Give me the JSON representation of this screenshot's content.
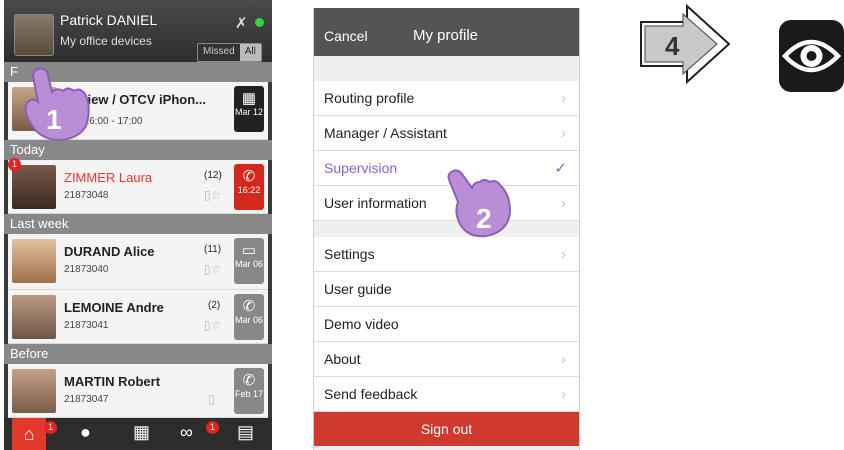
{
  "phone1": {
    "header": {
      "name": "Patrick DANIEL",
      "subtitle": "My office devices",
      "filter_missed": "Missed",
      "filter_all": "All",
      "mute_icon": "mute-icon",
      "status_color": "#38d23e"
    },
    "sections": {
      "f": "F",
      "today": "Today",
      "last_week": "Last week",
      "before": "Before"
    },
    "rows": [
      {
        "title": "review / OTCV iPhon...",
        "subtitle": "ow 16:00 - 17:00",
        "count": "",
        "tile_icon": "calendar-icon",
        "tile_date": "Mar 12"
      },
      {
        "title": "ZIMMER Laura",
        "subtitle": "21873048",
        "count": "(12)",
        "tile_icon": "phone-icon",
        "tile_date": "16:22",
        "badge": "1"
      },
      {
        "title": "DURAND Alice",
        "subtitle": "21873040",
        "count": "(11)",
        "tile_icon": "chat-icon",
        "tile_date": "Mar 06"
      },
      {
        "title": "LEMOINE Andre",
        "subtitle": "21873041",
        "count": "(2)",
        "tile_icon": "phone-icon",
        "tile_date": "Mar 06"
      },
      {
        "title": "MARTIN Robert",
        "subtitle": "21873047",
        "count": "",
        "tile_icon": "phone-icon",
        "tile_date": "Feb 17"
      }
    ],
    "tabbar": {
      "home_badge": "1",
      "voicemail_badge": "1"
    },
    "step_marker": "1"
  },
  "phone2": {
    "header": {
      "cancel": "Cancel",
      "title": "My profile"
    },
    "group1": [
      {
        "label": "Routing profile",
        "indicator": "›"
      },
      {
        "label": "Manager / Assistant",
        "indicator": "›"
      },
      {
        "label": "Supervision",
        "indicator": "✓"
      },
      {
        "label": "User information",
        "indicator": "›"
      }
    ],
    "group2": [
      {
        "label": "Settings",
        "indicator": "›"
      },
      {
        "label": "User guide",
        "indicator": ""
      },
      {
        "label": "Demo video",
        "indicator": ""
      },
      {
        "label": "About",
        "indicator": "›"
      },
      {
        "label": "Send feedback",
        "indicator": "›"
      }
    ],
    "sign_out": "Sign out",
    "step_marker": "2",
    "accent": "#8b5fd9"
  },
  "step4": {
    "label": "4"
  },
  "eye_icon": "eye-icon"
}
